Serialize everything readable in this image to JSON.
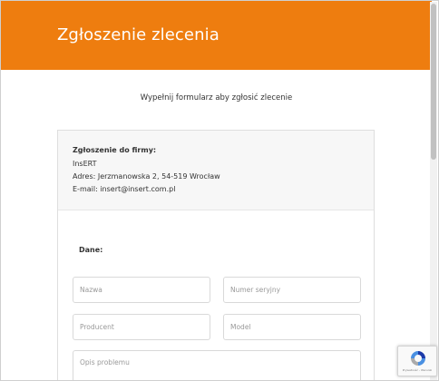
{
  "header": {
    "title": "Zgłoszenie zlecenia"
  },
  "subtitle": "Wypełnij formularz aby zgłosić zlecenie",
  "company": {
    "heading": "Zgłoszenie do firmy:",
    "name": "InsERT",
    "address": "Adres: Jerzmanowska 2, 54-519 Wrocław",
    "email": "E-mail: insert@insert.com.pl"
  },
  "form": {
    "section_label": "Dane:",
    "fields": {
      "nazwa": {
        "placeholder": "Nazwa",
        "value": ""
      },
      "numer_seryjny": {
        "placeholder": "Numer seryjny",
        "value": ""
      },
      "producent": {
        "placeholder": "Producent",
        "value": ""
      },
      "model": {
        "placeholder": "Model",
        "value": ""
      },
      "opis_problemu": {
        "placeholder": "Opis problemu",
        "value": ""
      }
    }
  },
  "recaptcha": {
    "label": "Prywatność - Warunki",
    "icon": "recaptcha-icon"
  },
  "colors": {
    "accent": "#ee7d0f",
    "panel": "#f7f7f7",
    "border": "#d9d9d9"
  }
}
